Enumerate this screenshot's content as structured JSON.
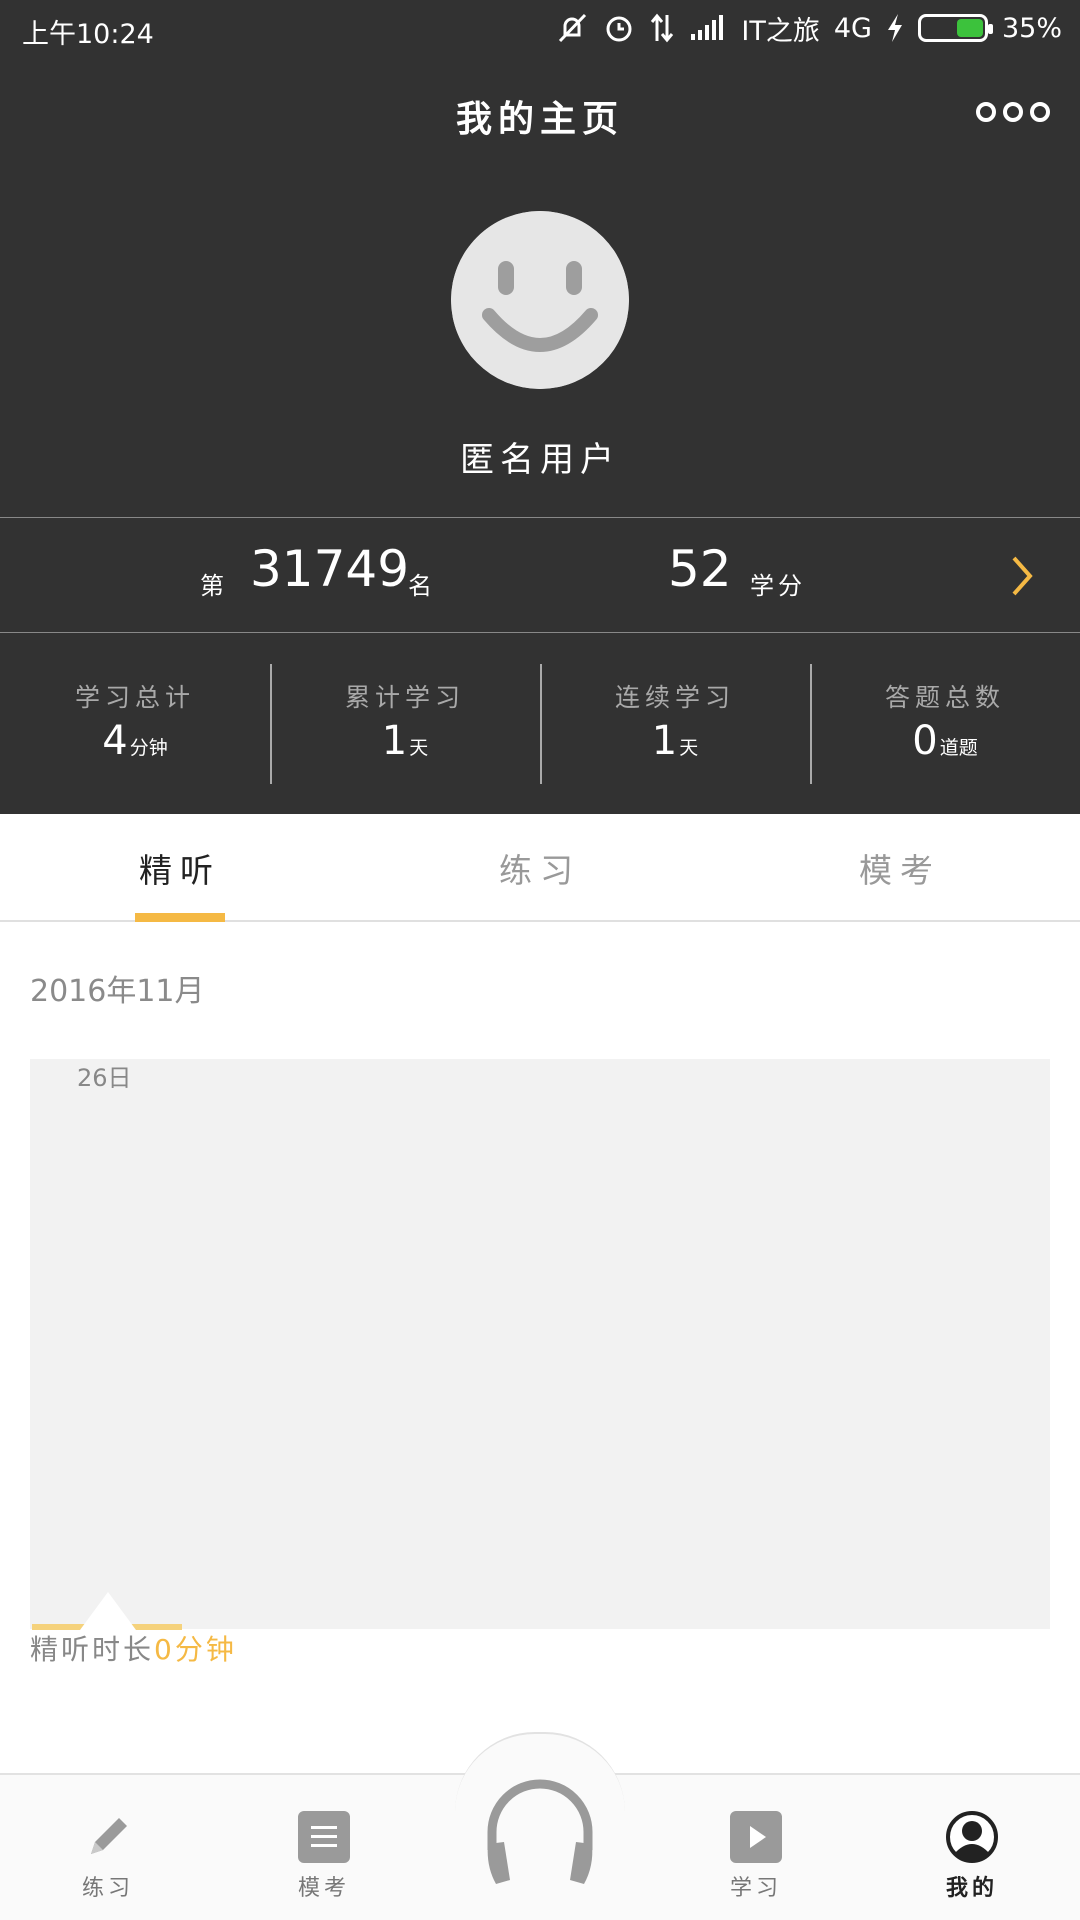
{
  "status_bar": {
    "time": "上午10:24",
    "carrier": "IT之旅",
    "network": "4G",
    "battery": "35%",
    "battery_level": 0.35
  },
  "header": {
    "title": "我的主页",
    "more_icon": "more-dots-icon"
  },
  "profile": {
    "avatar_icon": "smiley-avatar-icon",
    "username": "匿名用户"
  },
  "rank": {
    "prefix": "第",
    "number": "31749",
    "suffix": "名",
    "credits": "52",
    "credits_suffix": "学分"
  },
  "stats": [
    {
      "label": "学习总计",
      "value": "4",
      "unit": "分钟"
    },
    {
      "label": "累计学习",
      "value": "1",
      "unit": "天"
    },
    {
      "label": "连续学习",
      "value": "1",
      "unit": "天"
    },
    {
      "label": "答题总数",
      "value": "0",
      "unit": "道题"
    }
  ],
  "tabs": [
    {
      "label": "精听",
      "active": true
    },
    {
      "label": "练习",
      "active": false
    },
    {
      "label": "模考",
      "active": false
    }
  ],
  "calendar": {
    "month": "2016年11月",
    "day": "26日",
    "caption_label": "精听时长",
    "caption_value": "0分钟"
  },
  "bottom_nav": [
    {
      "label": "练习",
      "icon": "pencil-icon",
      "active": false
    },
    {
      "label": "模考",
      "icon": "list-icon",
      "active": false
    },
    {
      "label": "",
      "icon": "headphones-icon",
      "active": false
    },
    {
      "label": "学习",
      "icon": "play-icon",
      "active": false
    },
    {
      "label": "我的",
      "icon": "user-icon",
      "active": true
    }
  ],
  "colors": {
    "header_bg": "#323232",
    "accent": "#f5b944",
    "battery_green": "#3cc23c"
  }
}
